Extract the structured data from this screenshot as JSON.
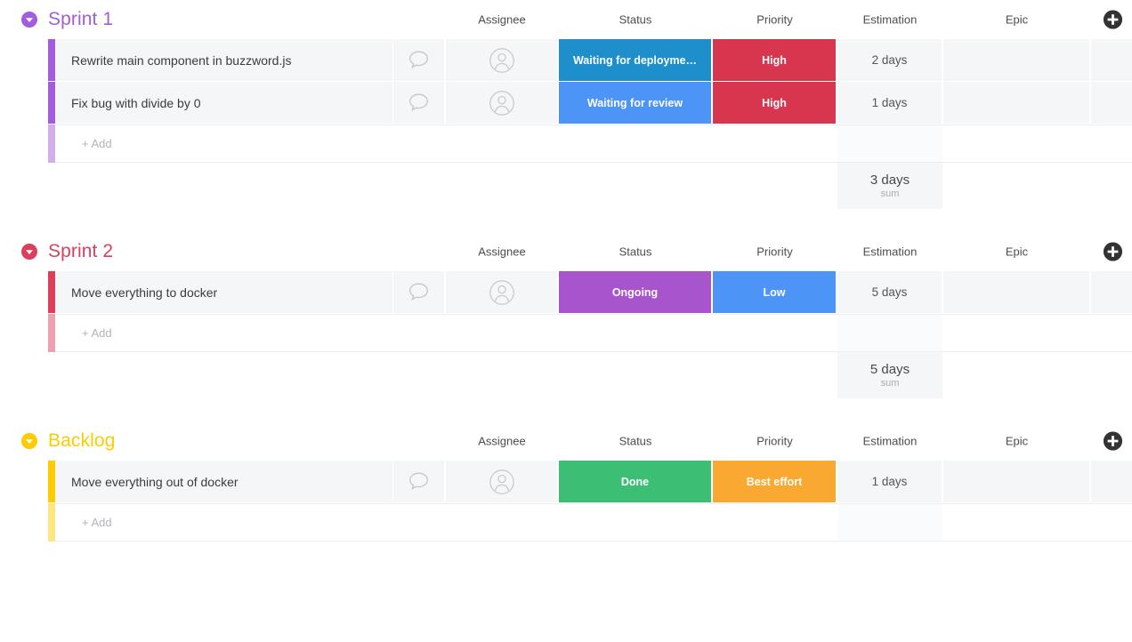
{
  "columns": [
    {
      "key": "title",
      "label": ""
    },
    {
      "key": "chat",
      "label": ""
    },
    {
      "key": "assignee",
      "label": "Assignee"
    },
    {
      "key": "status",
      "label": "Status"
    },
    {
      "key": "priority",
      "label": "Priority"
    },
    {
      "key": "estimation",
      "label": "Estimation"
    },
    {
      "key": "epic",
      "label": "Epic"
    }
  ],
  "icons": {
    "collapse": "chevron-down-circle-icon",
    "add_column": "plus-circle-icon",
    "chat": "chat-bubble-icon",
    "assignee": "person-circle-icon"
  },
  "add_row_label": "+ Add",
  "sum_label": "sum",
  "colors": {
    "sprint1": "#a martin",
    "purple": "#a martin2"
  },
  "groups": [
    {
      "name": "Sprint 1",
      "color": "#a25ddc",
      "color_light": "#d2aeea",
      "sum": "3 days",
      "items": [
        {
          "title": "Rewrite main component in buzzword.js",
          "status": {
            "label": "Waiting for deployme…",
            "color": "#1e8fcb"
          },
          "priority": {
            "label": "High",
            "color": "#d8364f"
          },
          "estimation": "2 days",
          "epic": ""
        },
        {
          "title": "Fix bug with divide by 0",
          "status": {
            "label": "Waiting for review",
            "color": "#4d94f7"
          },
          "priority": {
            "label": "High",
            "color": "#d8364f"
          },
          "estimation": "1 days",
          "epic": ""
        }
      ]
    },
    {
      "name": "Sprint 2",
      "color": "#dc3e5c",
      "color_light": "#eda0ae",
      "sum": "5 days",
      "items": [
        {
          "title": "Move everything to docker",
          "status": {
            "label": "Ongoing",
            "color": "#a martin",
            "colorHex": "#a martin"
          },
          "priority": {
            "label": "Low",
            "color": "#4d94f7"
          },
          "estimation": "5 days",
          "epic": ""
        }
      ]
    },
    {
      "name": "Backlog",
      "color": "#fdcb00",
      "color_light": "#fde582",
      "sum": "",
      "items": [
        {
          "title": "Move everything out of docker",
          "status": {
            "label": "Done",
            "color": "#3cbf75"
          },
          "priority": {
            "label": "Best effort",
            "color": "#f9a831"
          },
          "estimation": "1 days",
          "epic": ""
        }
      ]
    }
  ]
}
